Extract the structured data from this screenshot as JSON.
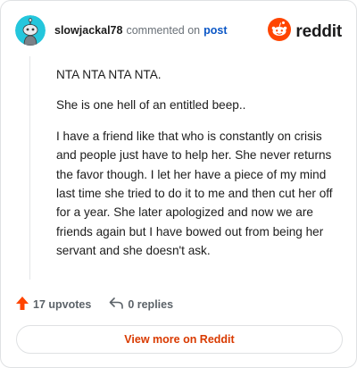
{
  "header": {
    "username": "slowjackal78",
    "action_text": "commented on",
    "post_link": "post",
    "brand_name": "reddit"
  },
  "comment": {
    "paragraphs": [
      "NTA NTA NTA NTA.",
      "She is one hell of an entitled beep..",
      "I have a friend like that who is constantly on crisis and people just have to help her. She never returns the favor though. I let her have a piece of my mind last time she tried to do it to me and then cut her off for a year. She later apologized and now we are friends again but I have bowed out from being her servant and she doesn't ask."
    ]
  },
  "actions": {
    "upvotes_label": "17 upvotes",
    "replies_label": "0 replies"
  },
  "footer": {
    "view_more_label": "View more on Reddit"
  },
  "colors": {
    "accent": "#d93a00",
    "upvote": "#ff4500",
    "link": "#0b57c6",
    "avatar_bg": "#24c6dc"
  },
  "icons": [
    "snoo-avatar-icon",
    "reddit-logo-icon",
    "upvote-arrow-icon",
    "reply-arrow-icon"
  ]
}
